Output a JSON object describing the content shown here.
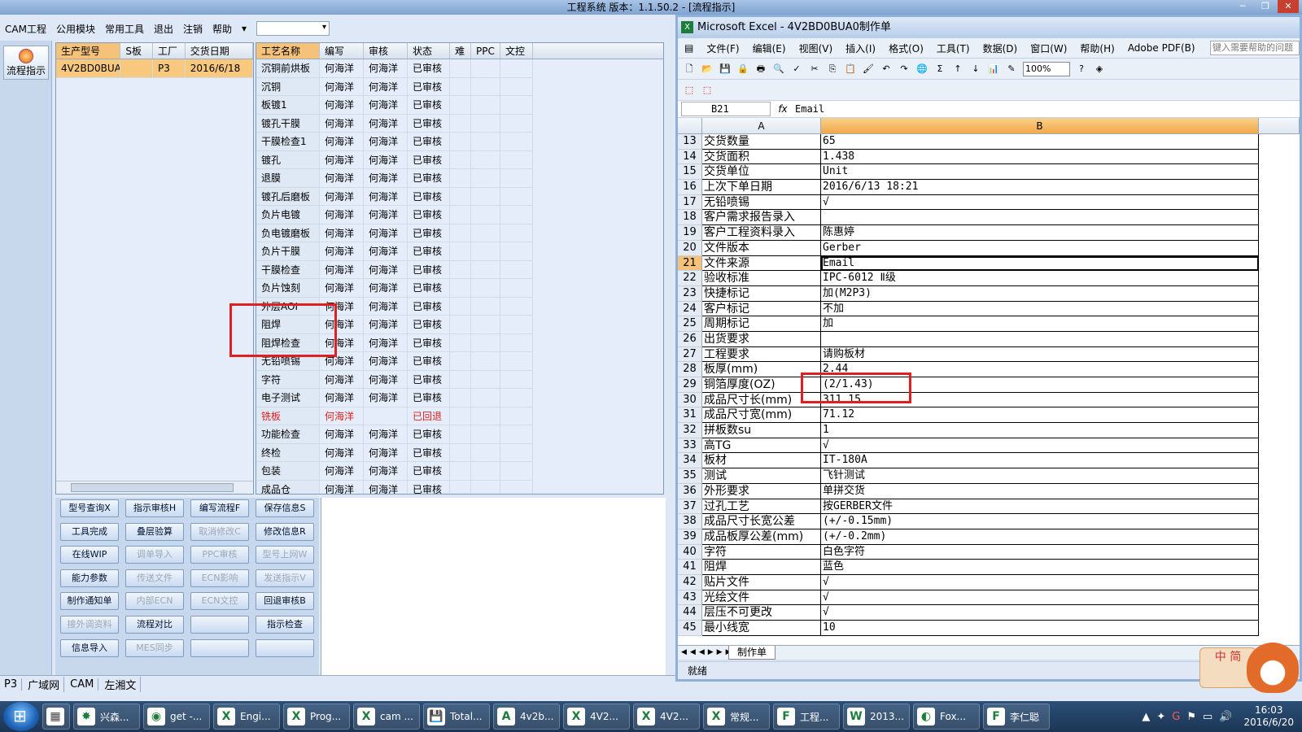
{
  "app": {
    "title": "工程系统    版本：1.1.50.2 - [流程指示]",
    "menu": [
      "CAM工程",
      "公用模块",
      "常用工具",
      "退出",
      "注销",
      "帮助"
    ],
    "left_button": "流程指示",
    "model_grid": {
      "headers": [
        "生产型号",
        "S板",
        "工厂",
        "交货日期"
      ],
      "rows": [
        [
          "4V2BD0BUA0",
          "",
          "P3",
          "2016/6/18"
        ]
      ]
    },
    "process_grid": {
      "headers": [
        "工艺名称",
        "编写",
        "审核",
        "状态",
        "难",
        "PPC",
        "文控"
      ],
      "rows": [
        [
          "沉铜前烘板",
          "何海洋",
          "何海洋",
          "已审核"
        ],
        [
          "沉铜",
          "何海洋",
          "何海洋",
          "已审核"
        ],
        [
          "板镀1",
          "何海洋",
          "何海洋",
          "已审核"
        ],
        [
          "镀孔干膜",
          "何海洋",
          "何海洋",
          "已审核"
        ],
        [
          "干膜检查1",
          "何海洋",
          "何海洋",
          "已审核"
        ],
        [
          "镀孔",
          "何海洋",
          "何海洋",
          "已审核"
        ],
        [
          "退膜",
          "何海洋",
          "何海洋",
          "已审核"
        ],
        [
          "镀孔后磨板",
          "何海洋",
          "何海洋",
          "已审核"
        ],
        [
          "负片电镀",
          "何海洋",
          "何海洋",
          "已审核"
        ],
        [
          "负电镀磨板",
          "何海洋",
          "何海洋",
          "已审核"
        ],
        [
          "负片干膜",
          "何海洋",
          "何海洋",
          "已审核"
        ],
        [
          "干膜检查",
          "何海洋",
          "何海洋",
          "已审核"
        ],
        [
          "负片蚀刻",
          "何海洋",
          "何海洋",
          "已审核"
        ],
        [
          "外层AOI",
          "何海洋",
          "何海洋",
          "已审核"
        ],
        [
          "阻焊",
          "何海洋",
          "何海洋",
          "已审核"
        ],
        [
          "阻焊检查",
          "何海洋",
          "何海洋",
          "已审核"
        ],
        [
          "无铅喷锡",
          "何海洋",
          "何海洋",
          "已审核"
        ],
        [
          "字符",
          "何海洋",
          "何海洋",
          "已审核"
        ],
        [
          "电子测试",
          "何海洋",
          "何海洋",
          "已审核"
        ],
        [
          "铣板",
          "何海洋",
          "",
          "已回退"
        ],
        [
          "功能检查",
          "何海洋",
          "何海洋",
          "已审核"
        ],
        [
          "终检",
          "何海洋",
          "何海洋",
          "已审核"
        ],
        [
          "包装",
          "何海洋",
          "何海洋",
          "已审核"
        ],
        [
          "成品仓",
          "何海洋",
          "何海洋",
          "已审核"
        ]
      ],
      "red_row_index": 19
    },
    "buttons": [
      [
        "型号查询X",
        "指示审核H",
        "编写流程F",
        "保存信息S"
      ],
      [
        "工具完成",
        "叠层验算",
        "取消修改C",
        "修改信息R"
      ],
      [
        "在线WIP",
        "调单导入",
        "PPC审核",
        "型号上网W"
      ],
      [
        "能力参数",
        "传送文件",
        "ECN影响",
        "发送指示V"
      ],
      [
        "制作通知单",
        "内部ECN",
        "ECN文控",
        "回退审核B"
      ],
      [
        "接外调资料",
        "流程对比",
        "",
        "指示检查"
      ],
      [
        "信息导入",
        "MES同步",
        "",
        ""
      ]
    ],
    "buttons_disabled": [
      [
        1,
        2
      ],
      [
        2,
        1
      ],
      [
        2,
        2
      ],
      [
        2,
        3
      ],
      [
        3,
        1
      ],
      [
        3,
        2
      ],
      [
        3,
        3
      ],
      [
        4,
        1
      ],
      [
        4,
        2
      ],
      [
        5,
        0
      ],
      [
        6,
        1
      ]
    ],
    "status": [
      "P3",
      "广域网",
      "CAM",
      "左湘文"
    ]
  },
  "excel": {
    "title": "Microsoft Excel - 4V2BD0BUA0制作单",
    "menu": [
      "文件(F)",
      "编辑(E)",
      "视图(V)",
      "插入(I)",
      "格式(O)",
      "工具(T)",
      "数据(D)",
      "窗口(W)",
      "帮助(H)",
      "Adobe PDF(B)"
    ],
    "help_placeholder": "键入需要帮助的问题",
    "zoom": "100%",
    "name_box": "B21",
    "fx": "fx",
    "formula": "Email",
    "col_headers": [
      "A",
      "B"
    ],
    "active_row": 21,
    "rows": [
      {
        "n": 13,
        "a": "交货数量",
        "b": "65"
      },
      {
        "n": 14,
        "a": "交货面积",
        "b": "1.438"
      },
      {
        "n": 15,
        "a": "交货单位",
        "b": "Unit"
      },
      {
        "n": 16,
        "a": "上次下单日期",
        "b": "2016/6/13 18:21"
      },
      {
        "n": 17,
        "a": "无铅喷锡",
        "b": "√"
      },
      {
        "n": 18,
        "a": "客户需求报告录入",
        "b": ""
      },
      {
        "n": 19,
        "a": "客户工程资料录入",
        "b": "陈惠婷"
      },
      {
        "n": 20,
        "a": "文件版本",
        "b": "Gerber"
      },
      {
        "n": 21,
        "a": "文件来源",
        "b": "Email"
      },
      {
        "n": 22,
        "a": "验收标准",
        "b": "IPC-6012 Ⅱ级"
      },
      {
        "n": 23,
        "a": "快捷标记",
        "b": "加(M2P3)"
      },
      {
        "n": 24,
        "a": "客户标记",
        "b": "不加"
      },
      {
        "n": 25,
        "a": "周期标记",
        "b": "加"
      },
      {
        "n": 26,
        "a": "出货要求",
        "b": ""
      },
      {
        "n": 27,
        "a": "工程要求",
        "b": "请购板材"
      },
      {
        "n": 28,
        "a": "板厚(mm)",
        "b": "2.44"
      },
      {
        "n": 29,
        "a": "铜箔厚度(OZ)",
        "b": " (2/1.43)"
      },
      {
        "n": 30,
        "a": "成品尺寸长(mm)",
        "b": "311.15"
      },
      {
        "n": 31,
        "a": "成品尺寸宽(mm)",
        "b": "71.12"
      },
      {
        "n": 32,
        "a": "拼板数su",
        "b": "1"
      },
      {
        "n": 33,
        "a": "高TG",
        "b": "√"
      },
      {
        "n": 34,
        "a": "板材",
        "b": "IT-180A"
      },
      {
        "n": 35,
        "a": "测试",
        "b": "飞针测试"
      },
      {
        "n": 36,
        "a": "外形要求",
        "b": "单拼交货"
      },
      {
        "n": 37,
        "a": "过孔工艺",
        "b": "按GERBER文件"
      },
      {
        "n": 38,
        "a": "成品尺寸长宽公差",
        "b": "(+/-0.15mm)"
      },
      {
        "n": 39,
        "a": "成品板厚公差(mm)",
        "b": "(+/-0.2mm)"
      },
      {
        "n": 40,
        "a": "字符",
        "b": "白色字符"
      },
      {
        "n": 41,
        "a": "阻焊",
        "b": "蓝色"
      },
      {
        "n": 42,
        "a": "贴片文件",
        "b": "√"
      },
      {
        "n": 43,
        "a": "光绘文件",
        "b": "√"
      },
      {
        "n": 44,
        "a": "层压不可更改",
        "b": "√"
      },
      {
        "n": 45,
        "a": "最小线宽",
        "b": "10"
      }
    ],
    "sheet_tab": "制作单",
    "status": "就绪"
  },
  "ime": {
    "label": "中 简"
  },
  "taskbar": {
    "items": [
      "兴森...",
      "get -...",
      "Engi...",
      "Prog...",
      "cam ...",
      "Total...",
      "4v2b...",
      "4V2...",
      "4V2...",
      "常规...",
      "工程...",
      "2013...",
      "Fox...",
      "李仁聪"
    ],
    "clock_time": "16:03",
    "clock_date": "2016/6/20"
  },
  "colors": {
    "highlight": "#e02020",
    "accent": "#f5c27a"
  }
}
